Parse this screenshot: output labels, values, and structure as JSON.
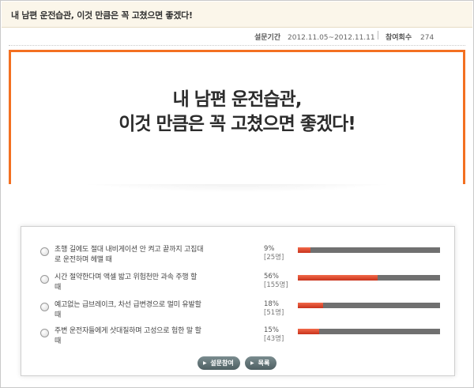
{
  "page_title": "내 남편 운전습관, 이것 만큼은 꼭 고쳤으면 좋겠다!",
  "meta": {
    "period_label": "설문기간",
    "period_value": "2012.11.05~2012.11.11",
    "count_label": "참여회수",
    "count_value": "274"
  },
  "hero": {
    "line1": "내 남편 운전습관,",
    "line2": "이것 만큼은 꼭 고쳤으면 좋겠다!"
  },
  "options": [
    {
      "label_line1": "초행 길에도 절대 내비게이션 안 켜고 끝까지 고집대",
      "label_line2": "로 운전하며 헤맬 때",
      "percent_text": "9%",
      "count_text": "[25명]",
      "percent": 9
    },
    {
      "label_line1": "시간 절약한다며 액셀 밟고 위험천만 과속 주행 할",
      "label_line2": "때",
      "percent_text": "56%",
      "count_text": "[155명]",
      "percent": 56
    },
    {
      "label_line1": "예고없는 급브레이크, 차선 급변경으로 멀미 유발할",
      "label_line2": "때",
      "percent_text": "18%",
      "count_text": "[51명]",
      "percent": 18
    },
    {
      "label_line1": "주변 운전자들에게 삿대질하며 고성으로 험한 말 할",
      "label_line2": "때",
      "percent_text": "15%",
      "count_text": "[43명]",
      "percent": 15
    }
  ],
  "buttons": {
    "participate": "설문참여",
    "list": "목록"
  },
  "colors": {
    "accent_orange": "#f37021",
    "bar_fill": "#d9432a",
    "bar_track": "#707070",
    "button": "#5f7073"
  }
}
